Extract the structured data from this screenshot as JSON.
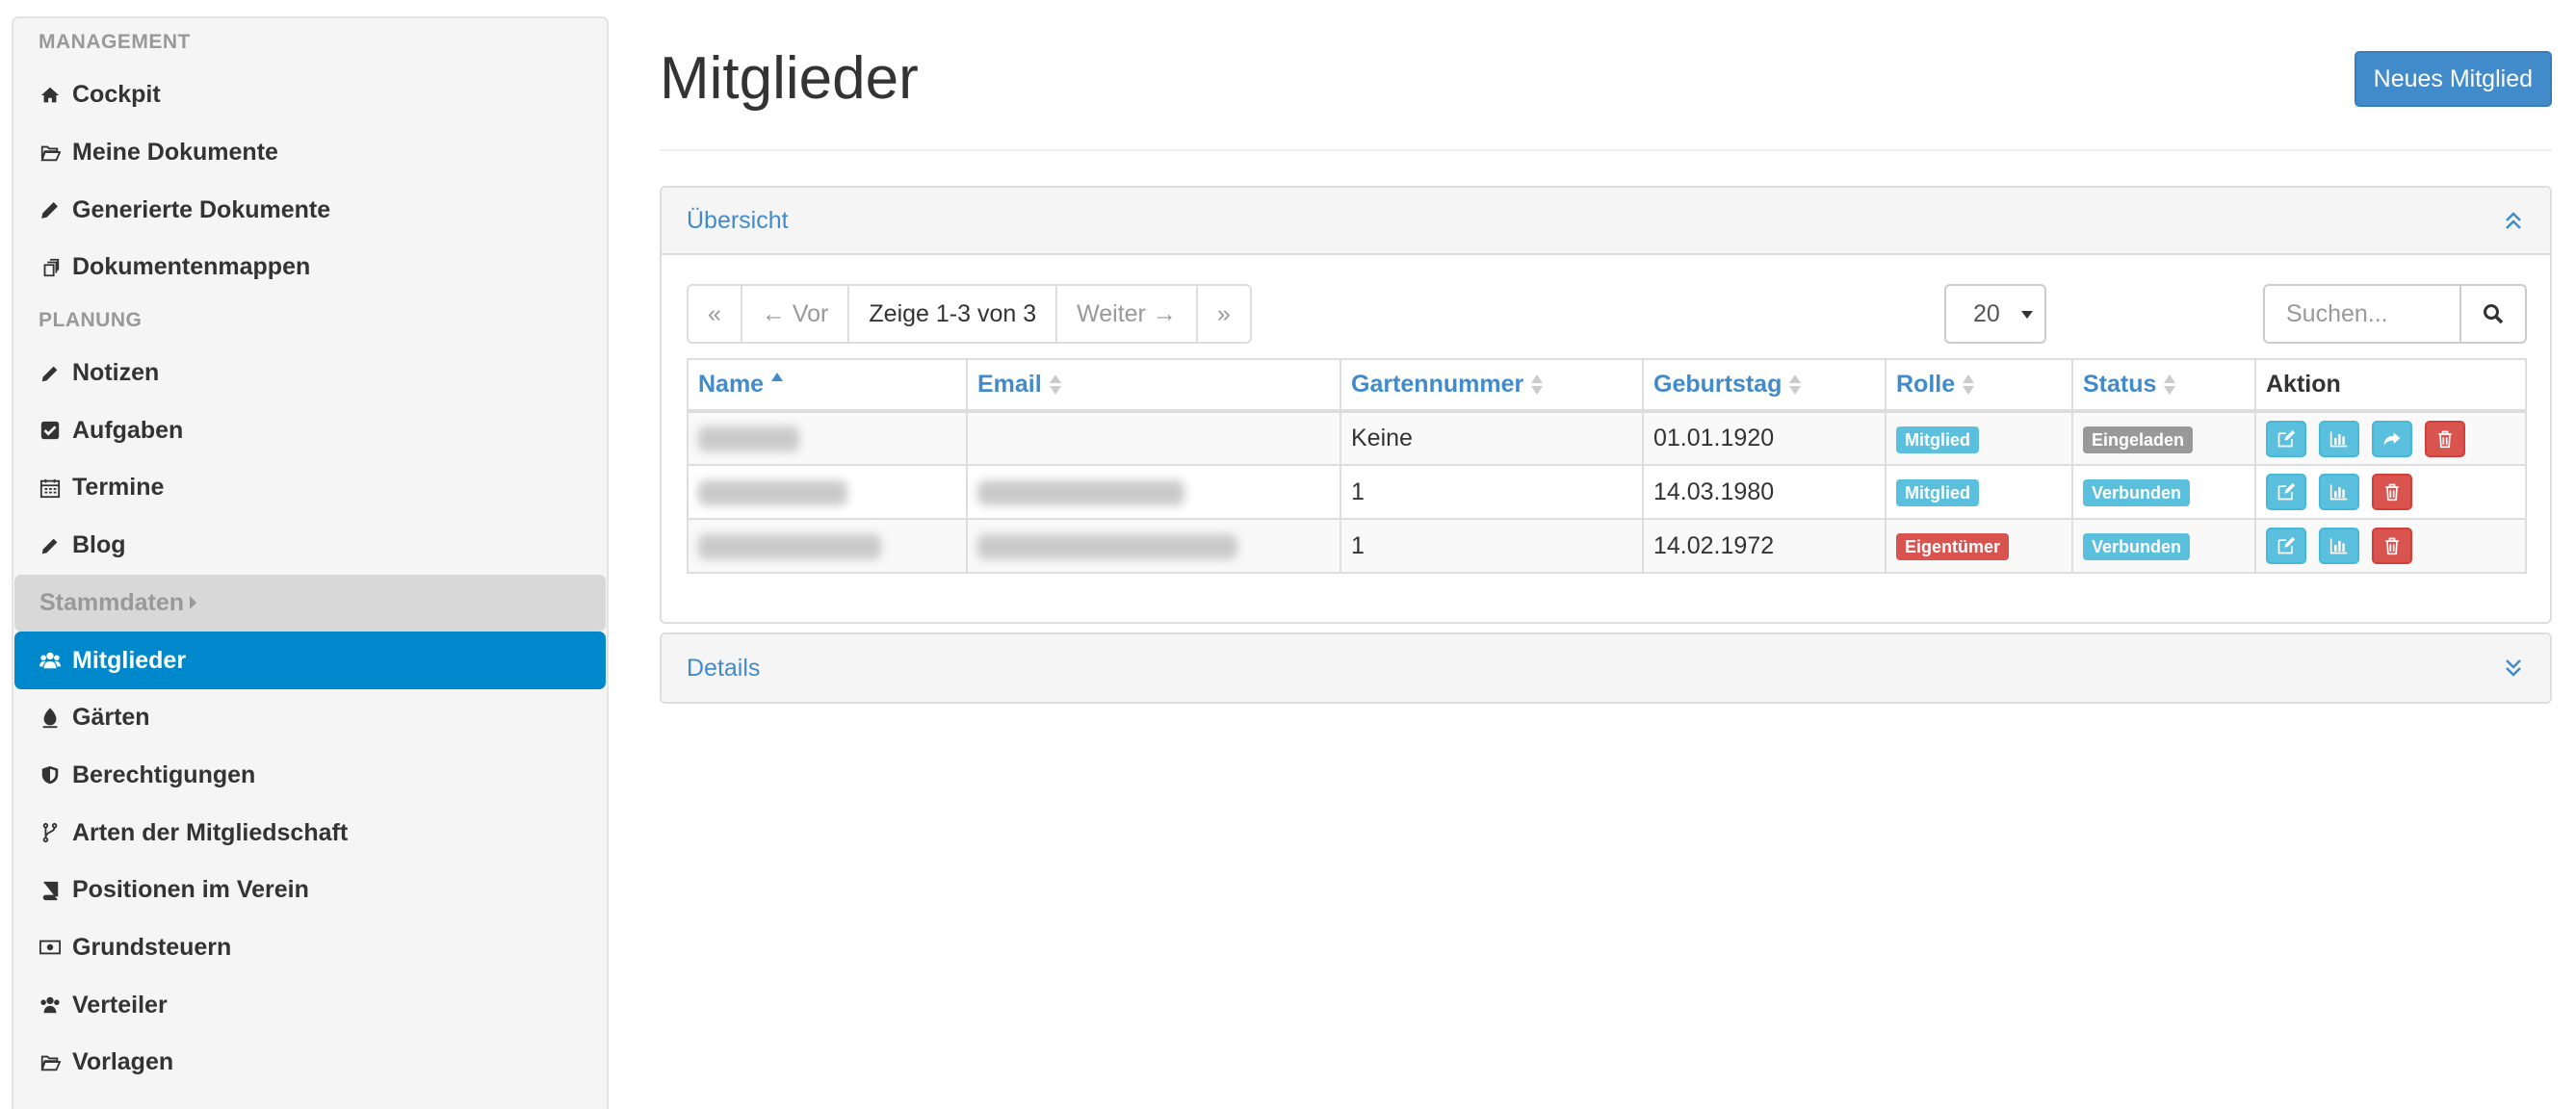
{
  "sidebar": {
    "sections": [
      {
        "heading": "MANAGEMENT"
      },
      {
        "heading": "PLANUNG"
      }
    ],
    "management": [
      "Cockpit",
      "Meine Dokumente",
      "Generierte Dokumente",
      "Dokumentenmappen"
    ],
    "planung": [
      "Notizen",
      "Aufgaben",
      "Termine",
      "Blog"
    ],
    "stammdaten_label": "Stammdaten",
    "stammdaten": [
      "Mitglieder",
      "Gärten",
      "Berechtigungen",
      "Arten der Mitgliedschaft",
      "Positionen im Verein",
      "Grundsteuern",
      "Verteiler",
      "Vorlagen"
    ]
  },
  "page": {
    "title": "Mitglieder",
    "new_button": "Neues Mitglied"
  },
  "overview_panel": {
    "title": "Übersicht",
    "pager": {
      "first": "«",
      "prev": "← Vor",
      "status": "Zeige 1-3 von 3",
      "next": "Weiter →",
      "last": "»"
    },
    "page_size": "20",
    "search_placeholder": "Suchen...",
    "columns": [
      "Name",
      "Email",
      "Gartennummer",
      "Geburtstag",
      "Rolle",
      "Status",
      "Aktion"
    ],
    "rows": [
      {
        "gartennummer": "Keine",
        "geburtstag": "01.01.1920",
        "rolle": "Mitglied",
        "status": "Eingeladen"
      },
      {
        "gartennummer": "1",
        "geburtstag": "14.03.1980",
        "rolle": "Mitglied",
        "status": "Verbunden"
      },
      {
        "gartennummer": "1",
        "geburtstag": "14.02.1972",
        "rolle": "Eigentümer",
        "status": "Verbunden"
      }
    ]
  },
  "details_panel": {
    "title": "Details"
  },
  "colors": {
    "primary": "#428bca",
    "active_nav": "#0088cc",
    "info": "#5bc0de",
    "danger": "#d9534f",
    "muted": "#999999"
  }
}
